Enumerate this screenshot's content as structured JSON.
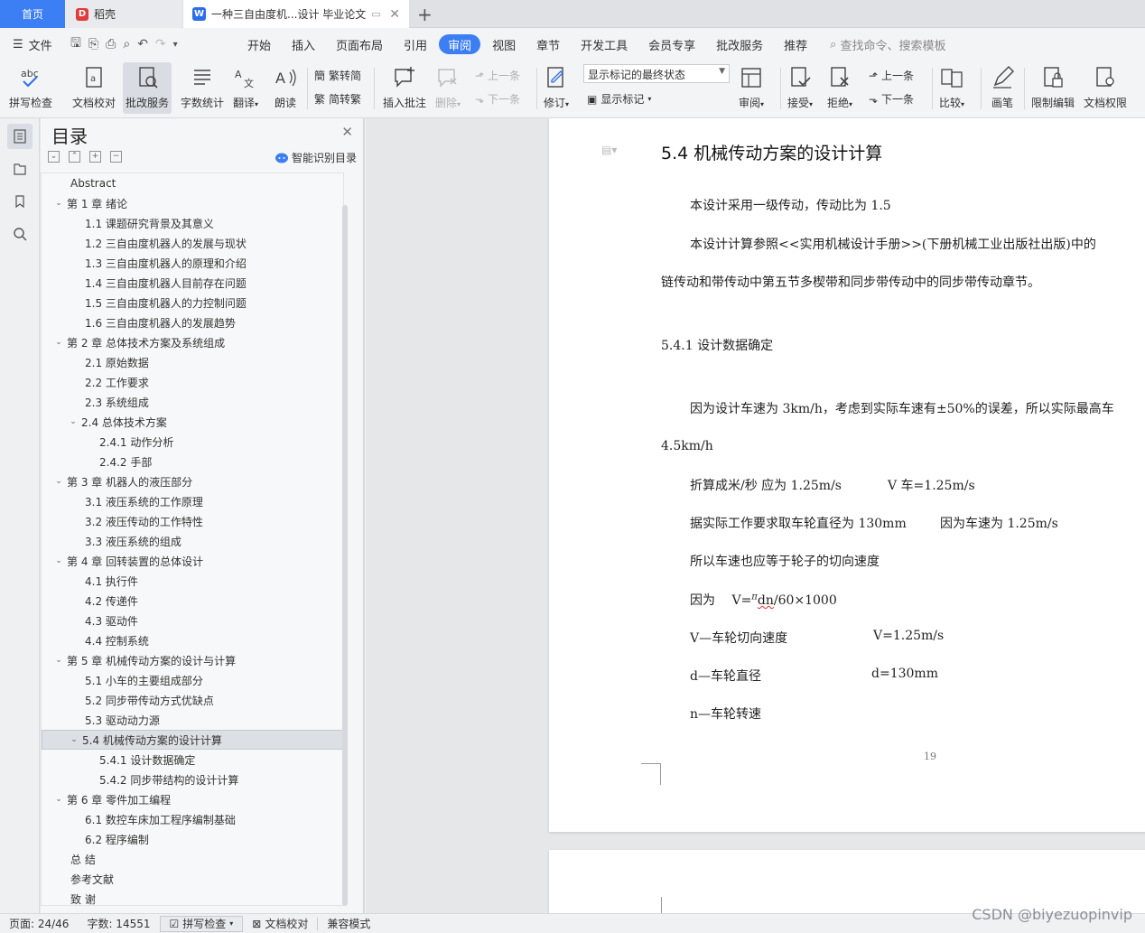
{
  "tabs": {
    "home": "首页",
    "daoke": "稻壳",
    "doc": "一种三自由度机...设计 毕业论文"
  },
  "menu": {
    "file": "文件",
    "items": [
      "开始",
      "插入",
      "页面布局",
      "引用",
      "审阅",
      "视图",
      "章节",
      "开发工具",
      "会员专享",
      "批改服务",
      "推荐"
    ],
    "active": "审阅",
    "search": "查找命令、搜索模板"
  },
  "toolbar": {
    "spell": "拼写检查",
    "proof": "文档校对",
    "review_service": "批改服务",
    "word_count": "字数统计",
    "translate": "翻译",
    "read": "朗读",
    "trad": "繁转简",
    "simp": "简转繁",
    "insert_comment": "插入批注",
    "delete": "删除",
    "prev1": "上一条",
    "next1": "下一条",
    "revise": "修订",
    "markup_state": "显示标记的最终状态",
    "show_markup": "显示标记",
    "review": "审阅",
    "accept": "接受",
    "reject": "拒绝",
    "prev2": "上一条",
    "next2": "下一条",
    "compare": "比较",
    "pen": "画笔",
    "restrict": "限制编辑",
    "permission": "文档权限"
  },
  "toc": {
    "title": "目录",
    "smart": "智能识别目录",
    "items": [
      {
        "text": "Abstract",
        "level": 1,
        "chev": false
      },
      {
        "text": "第 1 章  绪论",
        "level": 1,
        "chev": true
      },
      {
        "text": "1.1 课题研究背景及其意义",
        "level": 2,
        "chev": false
      },
      {
        "text": "1.2 三自由度机器人的发展与现状",
        "level": 2,
        "chev": false
      },
      {
        "text": "1.3 三自由度机器人的原理和介绍",
        "level": 2,
        "chev": false
      },
      {
        "text": "1.4 三自由度机器人目前存在问题",
        "level": 2,
        "chev": false
      },
      {
        "text": "1.5 三自由度机器人的力控制问题",
        "level": 2,
        "chev": false
      },
      {
        "text": "1.6 三自由度机器人的发展趋势",
        "level": 2,
        "chev": false
      },
      {
        "text": "第 2 章  总体技术方案及系统组成",
        "level": 1,
        "chev": true
      },
      {
        "text": "2.1 原始数据",
        "level": 2,
        "chev": false
      },
      {
        "text": "2.2 工作要求",
        "level": 2,
        "chev": false
      },
      {
        "text": "2.3 系统组成",
        "level": 2,
        "chev": false
      },
      {
        "text": "2.4 总体技术方案",
        "level": 2,
        "chev": true
      },
      {
        "text": "2.4.1  动作分析",
        "level": 3,
        "chev": false
      },
      {
        "text": "2.4.2  手部",
        "level": 3,
        "chev": false
      },
      {
        "text": "第 3 章  机器人的液压部分",
        "level": 1,
        "chev": true
      },
      {
        "text": "3.1 液压系统的工作原理",
        "level": 2,
        "chev": false
      },
      {
        "text": "3.2 液压传动的工作特性",
        "level": 2,
        "chev": false
      },
      {
        "text": "3.3 液压系统的组成",
        "level": 2,
        "chev": false
      },
      {
        "text": "第 4 章  回转装置的总体设计",
        "level": 1,
        "chev": true
      },
      {
        "text": "4.1 执行件",
        "level": 2,
        "chev": false
      },
      {
        "text": "4.2 传递件",
        "level": 2,
        "chev": false
      },
      {
        "text": "4.3 驱动件",
        "level": 2,
        "chev": false
      },
      {
        "text": "4.4 控制系统",
        "level": 2,
        "chev": false
      },
      {
        "text": "第 5 章  机械传动方案的设计与计算",
        "level": 1,
        "chev": true
      },
      {
        "text": "5.1 小车的主要组成部分",
        "level": 2,
        "chev": false
      },
      {
        "text": "5.2 同步带传动方式优缺点",
        "level": 2,
        "chev": false
      },
      {
        "text": "5.3 驱动动力源",
        "level": 2,
        "chev": false
      },
      {
        "text": "5.4 机械传动方案的设计计算",
        "level": 2,
        "chev": true,
        "current": true
      },
      {
        "text": "5.4.1 设计数据确定",
        "level": 3,
        "chev": false
      },
      {
        "text": "5.4.2 同步带结构的设计计算",
        "level": 3,
        "chev": false
      },
      {
        "text": "第 6 章  零件加工编程",
        "level": 1,
        "chev": true
      },
      {
        "text": "6.1 数控车床加工程序编制基础",
        "level": 2,
        "chev": false
      },
      {
        "text": "6.2 程序编制",
        "level": 2,
        "chev": false
      },
      {
        "text": "总    结",
        "level": 1,
        "chev": false
      },
      {
        "text": "参考文献",
        "level": 1,
        "chev": false
      },
      {
        "text": "致    谢",
        "level": 1,
        "chev": false
      }
    ]
  },
  "doc": {
    "heading": "5.4 机械传动方案的设计计算",
    "para1": "本设计采用一级传动，传动比为 1.5",
    "para2a": "本设计计算参照<<实用机械设计手册>>(下册机械工业出版社出版)中的",
    "para2b": "链传动和带传动中第五节多楔带和同步带传动中的同步带传动章节。",
    "sub": "5.4.1 设计数据确定",
    "para3a": "因为设计车速为 3km/h，考虑到实际车速有±50%的误差，所以实际最高车",
    "para3b": "4.5km/h",
    "line4a": "折算成米/秒  应为 1.25m/s",
    "line4b": "V 车=1.25m/s",
    "line5a": "据实际工作要求取车轮直径为 130mm",
    "line5b": "因为车速为 1.25m/s",
    "line6": "所以车速也应等于轮子的切向速度",
    "line7a": "因为",
    "line7b": "V=",
    "line7pi": "π",
    "line7c": "dn",
    "line7d": "/60×1000",
    "line8a": "V—车轮切向速度",
    "line8b": "V=1.25m/s",
    "line9a": "d—车轮直径",
    "line9b": "d=130mm",
    "line10": "n—车轮转速",
    "page_number": "19"
  },
  "status": {
    "page": "页面: 24/46",
    "words": "字数: 14551",
    "spell": "拼写检查",
    "proof": "文档校对",
    "compat": "兼容模式"
  },
  "watermark": "CSDN @biyezuopinvip"
}
